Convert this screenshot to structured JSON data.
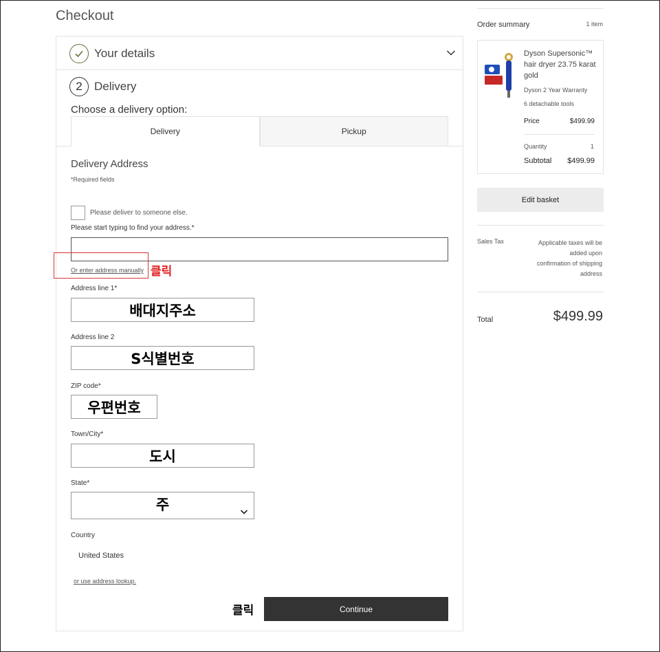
{
  "checkout": {
    "title": "Checkout",
    "step1": {
      "number": "✓",
      "title": "Your details"
    },
    "step2": {
      "number": "2",
      "title": "Delivery"
    },
    "choose_label": "Choose a delivery option:",
    "tabs": [
      {
        "label": "Delivery",
        "active": true
      },
      {
        "label": "Pickup",
        "active": false
      }
    ],
    "address_title": "Delivery Address",
    "required_note": "*Required fields",
    "someone_else_label": "Please deliver to someone else.",
    "lookup_label": "Please start typing to find your address.*",
    "lookup_value": "",
    "manual_link": "Or enter address manually",
    "fields": {
      "address1": {
        "label": "Address line 1*",
        "value": "배대지주소"
      },
      "address2": {
        "label": "Address line 2",
        "value": "S식별번호"
      },
      "zip": {
        "label": "ZIP code*",
        "value": "우편번호"
      },
      "city": {
        "label": "Town/City*",
        "value": "도시"
      },
      "state": {
        "label": "State*",
        "value": "주"
      }
    },
    "country_label": "Country",
    "country_value": "United States",
    "lookup_link": "or use address lookup.",
    "continue_label": "Continue"
  },
  "annotations": {
    "click_1": "클릭",
    "click_2": "클릭"
  },
  "summary": {
    "title": "Order summary",
    "count": "1 item",
    "product": {
      "name": "Dyson Supersonic™ hair dryer 23.75 karat gold",
      "warranty": "Dyson 2 Year Warranty",
      "tools": "6 detachable tools",
      "price_label": "Price",
      "price": "$499.99",
      "qty_label": "Quantity",
      "qty": "1",
      "subtotal_label": "Subtotal",
      "subtotal": "$499.99"
    },
    "edit_label": "Edit basket",
    "tax_label": "Sales Tax",
    "tax_note": "Applicable taxes will be added upon confirmation of shipping address",
    "total_label": "Total",
    "total": "$499.99"
  },
  "colors": {
    "annotation_red": "#e02020",
    "button_dark": "#333333",
    "step_done": "#6b6b3a"
  },
  "icons": {
    "step1": "check-circle-icon",
    "expand": "chevron-down-icon",
    "product": "hair-dryer-image"
  }
}
